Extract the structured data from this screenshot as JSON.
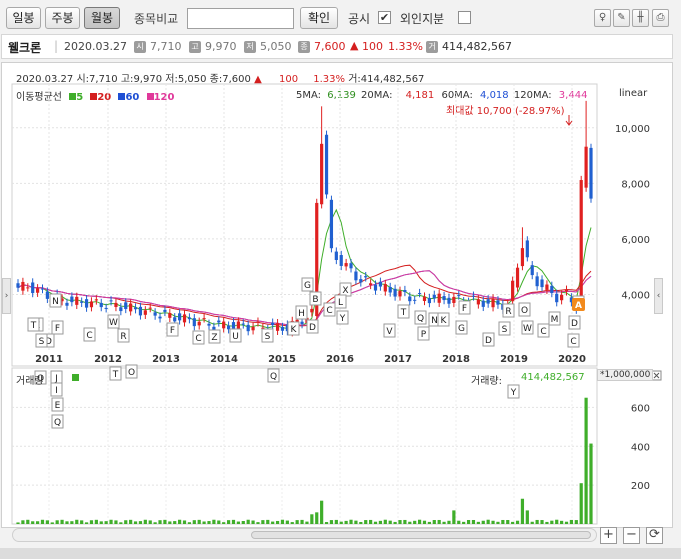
{
  "toolbar": {
    "tab_daily": "일봉",
    "tab_weekly": "주봉",
    "tab_monthly": "월봉",
    "compare_label": "종목비교",
    "compare_input_value": "",
    "confirm_button": "확인",
    "disclosure_label": "공시",
    "disclosure_checked": "✔",
    "foreign_label": "외인지분",
    "foreign_checked": ""
  },
  "infobar": {
    "stock_name": "웰크론",
    "date": "2020.03.27",
    "open_icon": "시",
    "open": "7,710",
    "high_icon": "고",
    "high": "9,970",
    "low_icon": "저",
    "low": "5,050",
    "close_icon": "종",
    "close": "7,600",
    "change_arrow": "▲",
    "change": "100",
    "change_pct": "1.33%",
    "volume_icon": "거",
    "volume": "414,482,567"
  },
  "chart_header": {
    "date": "2020.03.27",
    "open_label": "시:",
    "open": "7,710",
    "high_label": "고:",
    "high": "9,970",
    "low_label": "저:",
    "low": "5,050",
    "close_label": "종:",
    "close": "7,600",
    "change_arrow": "▲",
    "change": "100",
    "change_pct": "1.33%",
    "volume_label": "거:",
    "volume": "414,482,567"
  },
  "ma_legend": {
    "title": "이동평균선",
    "items": [
      "5",
      "20",
      "60",
      "120"
    ],
    "colors": [
      "#3fae2a",
      "#d41f1f",
      "#1f4fd4",
      "#e0389a"
    ]
  },
  "ma_values": {
    "ma5_label": "5MA:",
    "ma5": "6,139",
    "ma20_label": "20MA:",
    "ma20": "4,181",
    "ma60_label": "60MA:",
    "ma60": "4,018",
    "ma120_label": "120MA:",
    "ma120": "3,444"
  },
  "scale_mode": "linear",
  "max_annotation": "최대값 10,700 (-28.97%)",
  "price_axis": {
    "ticks": [
      "10,000",
      "8,000",
      "6,000",
      "4,000"
    ],
    "tick_values": [
      10000,
      8000,
      6000,
      4000
    ]
  },
  "x_axis": {
    "years": [
      "2011",
      "2012",
      "2013",
      "2014",
      "2015",
      "2016",
      "2017",
      "2018",
      "2019",
      "2020"
    ]
  },
  "volume_panel": {
    "title": "거래량",
    "legend_color": "#3fae2a",
    "value_label": "거래량:",
    "value": "414,482,567",
    "unit": "*1,000,000",
    "ticks": [
      "600",
      "400",
      "200"
    ],
    "tick_values": [
      600,
      400,
      200
    ]
  },
  "event_markers": [
    "E",
    "T",
    "F",
    "D",
    "C",
    "J",
    "Q",
    "X",
    "O",
    "S",
    "W",
    "R",
    "N",
    "Z",
    "U",
    "K",
    "H",
    "P",
    "G",
    "V",
    "L",
    "Y",
    "M",
    "A",
    "I",
    "B"
  ],
  "chart_data": {
    "type": "candlestick",
    "x_range": [
      "2010-06",
      "2020-03"
    ],
    "y_range": [
      2000,
      11000
    ],
    "grid": true,
    "key_points": [
      {
        "date": "2015-07",
        "high": 10100
      },
      {
        "date": "2018-02",
        "high": 6300
      },
      {
        "date": "2020-03",
        "high": 10700,
        "close": 7600
      }
    ],
    "volume_range": [
      0,
      700
    ],
    "volume_last": 414
  },
  "controls": {
    "zoom_in": "+",
    "zoom_out": "−",
    "reset": "⟳"
  },
  "colors": {
    "up": "#e02020",
    "down": "#2060d0",
    "volume": "#3fae2a",
    "grid": "#dcdcdc"
  }
}
